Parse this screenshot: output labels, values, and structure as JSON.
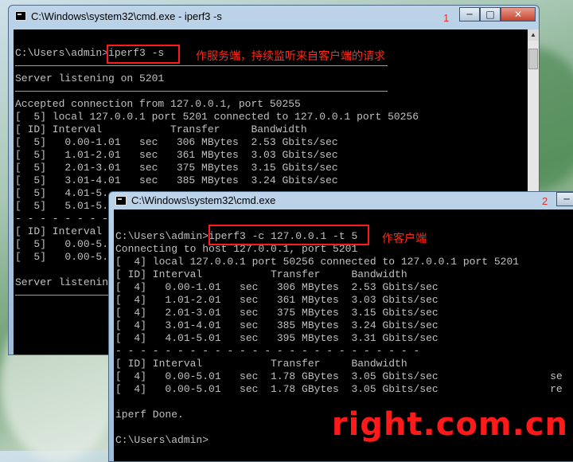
{
  "window1": {
    "title": "C:\\Windows\\system32\\cmd.exe - iperf3  -s",
    "number": "1",
    "controls": {
      "minimize": "─",
      "maximize": "□",
      "close": "✕"
    },
    "lines": [
      "C:\\Users\\admin>iperf3 -s",
      "Server listening on 5201",
      "Accepted connection from 127.0.0.1, port 50255",
      "[  5] local 127.0.0.1 port 5201 connected to 127.0.0.1 port 50256",
      "[ ID] Interval           Transfer     Bandwidth",
      "[  5]   0.00-1.01   sec   306 MBytes  2.53 Gbits/sec",
      "[  5]   1.01-2.01   sec   361 MBytes  3.03 Gbits/sec",
      "[  5]   2.01-3.01   sec   375 MBytes  3.15 Gbits/sec",
      "[  5]   3.01-4.01   sec   385 MBytes  3.24 Gbits/sec",
      "[  5]   4.01-5.",
      "[  5]   5.01-5.",
      "- - - - - - - -",
      "[ ID] Interval",
      "[  5]   0.00-5.",
      "[  5]   0.00-5.",
      "Server listenin"
    ],
    "annotation": "作服务端，持续监听来自客户端的请求"
  },
  "window2": {
    "title": "C:\\Windows\\system32\\cmd.exe",
    "number": "2",
    "lines": [
      "C:\\Users\\admin>iperf3 -c 127.0.0.1 -t 5",
      "Connecting to host 127.0.0.1, port 5201",
      "[  4] local 127.0.0.1 port 50256 connected to 127.0.0.1 port 5201",
      "[ ID] Interval           Transfer     Bandwidth",
      "[  4]   0.00-1.01   sec   306 MBytes  2.53 Gbits/sec",
      "[  4]   1.01-2.01   sec   361 MBytes  3.03 Gbits/sec",
      "[  4]   2.01-3.01   sec   375 MBytes  3.15 Gbits/sec",
      "[  4]   3.01-4.01   sec   385 MBytes  3.24 Gbits/sec",
      "[  4]   4.01-5.01   sec   395 MBytes  3.31 Gbits/sec",
      "- - - - - - - - - - - - - - - - - - - - - - - - -",
      "[ ID] Interval           Transfer     Bandwidth",
      "[  4]   0.00-5.01   sec  1.78 GBytes  3.05 Gbits/sec                  se",
      "[  4]   0.00-5.01   sec  1.78 GBytes  3.05 Gbits/sec                  re",
      "iperf Done.",
      "C:\\Users\\admin>"
    ],
    "annotation": "作客户端"
  },
  "watermark": "right.com.cn",
  "colors": {
    "annotation": "#ff1a1a",
    "console_bg": "#000000",
    "console_text": "#c0c0c0"
  }
}
